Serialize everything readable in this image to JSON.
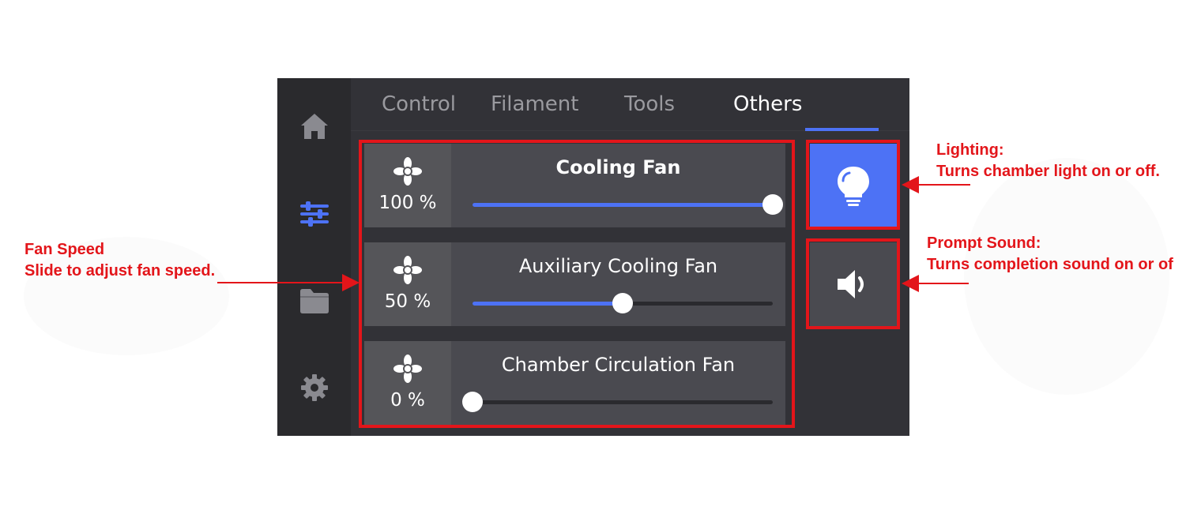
{
  "tabs": [
    {
      "label": "Control",
      "active": false
    },
    {
      "label": "Filament",
      "active": false
    },
    {
      "label": "Tools",
      "active": false
    },
    {
      "label": "Others",
      "active": true
    }
  ],
  "sidebar": {
    "items": [
      {
        "icon": "home-icon"
      },
      {
        "icon": "sliders-icon",
        "active": true
      },
      {
        "icon": "folder-icon"
      },
      {
        "icon": "gear-icon"
      }
    ]
  },
  "fans": [
    {
      "name": "Cooling Fan",
      "percent_label": "100 %",
      "value": 100
    },
    {
      "name": "Auxiliary Cooling Fan",
      "percent_label": "50 %",
      "value": 50
    },
    {
      "name": "Chamber Circulation Fan",
      "percent_label": "0 %",
      "value": 0
    }
  ],
  "buttons": {
    "lighting": {
      "icon": "lightbulb-icon",
      "on": true
    },
    "sound": {
      "icon": "speaker-icon",
      "on": false
    }
  },
  "annotations": {
    "fan_speed": {
      "title": "Fan Speed",
      "text": "Slide to adjust fan speed."
    },
    "lighting": {
      "title": "Lighting:",
      "text": "Turns chamber light on or off."
    },
    "sound": {
      "title": "Prompt Sound:",
      "text": "Turns completion sound on or of"
    }
  },
  "colors": {
    "accent": "#4d72f5",
    "annotation": "#e3151a",
    "panel": "#4a4a50",
    "background": "#2b2b30"
  }
}
